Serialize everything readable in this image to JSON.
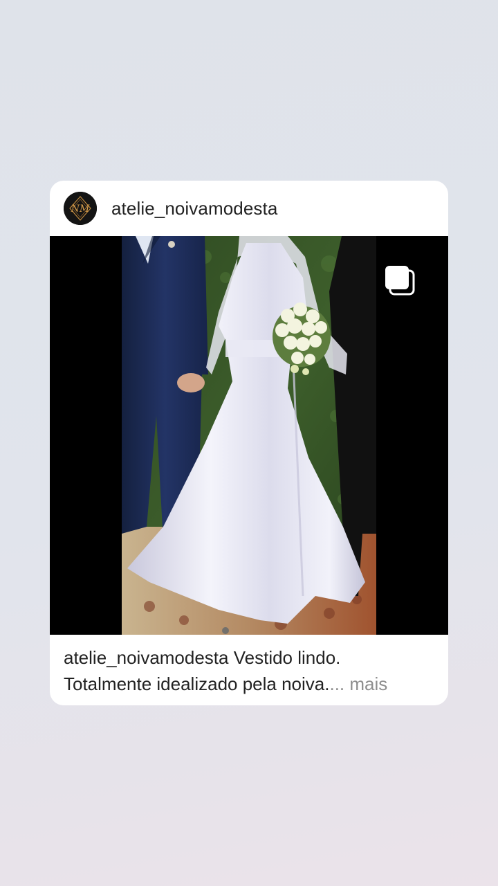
{
  "post": {
    "username": "atelie_noivamodesta",
    "caption": {
      "username": "atelie_noivamodesta",
      "line1_text": " Vestido lindo.",
      "line2_text": "Totalmente idealizado pela noiva.",
      "ellipsis": "...",
      "more_label": " mais"
    },
    "avatar_monogram": "NM",
    "media_icon": "multiple-images-icon"
  },
  "colors": {
    "background": "#e0e4eb",
    "card": "#ffffff",
    "text": "#222222",
    "muted": "#8e8e8e",
    "media_background": "#000000",
    "avatar_gold": "#c08a3e"
  }
}
